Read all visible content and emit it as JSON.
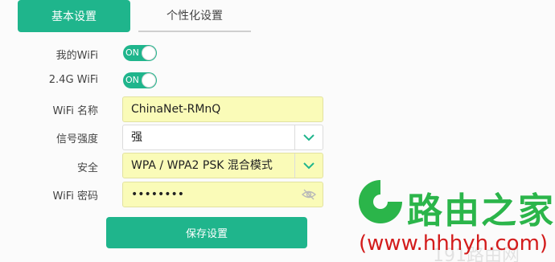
{
  "tabs": [
    {
      "label": "基本设置",
      "active": true
    },
    {
      "label": "个性化设置",
      "active": false
    }
  ],
  "form": {
    "my_wifi": {
      "label": "我的WiFi",
      "toggle": "ON"
    },
    "wifi_24g": {
      "label": "2.4G WiFi",
      "toggle": "ON"
    },
    "wifi_name": {
      "label": "WiFi 名称",
      "value": "ChinaNet-RMnQ"
    },
    "signal": {
      "label": "信号强度",
      "value": "强"
    },
    "security": {
      "label": "安全",
      "value": "WPA / WPA2 PSK 混合模式"
    },
    "password": {
      "label": "WiFi 密码",
      "value": "••••••••"
    }
  },
  "save_button": "保存设置",
  "watermark": {
    "title": "路由之家",
    "url": "(www.hhhyh.com)",
    "faint": "191路由网"
  },
  "colors": {
    "accent": "#1fb58c",
    "autofill": "#fafbb8",
    "watermark_green": "#2bb54a",
    "watermark_red": "#d31c1c"
  }
}
